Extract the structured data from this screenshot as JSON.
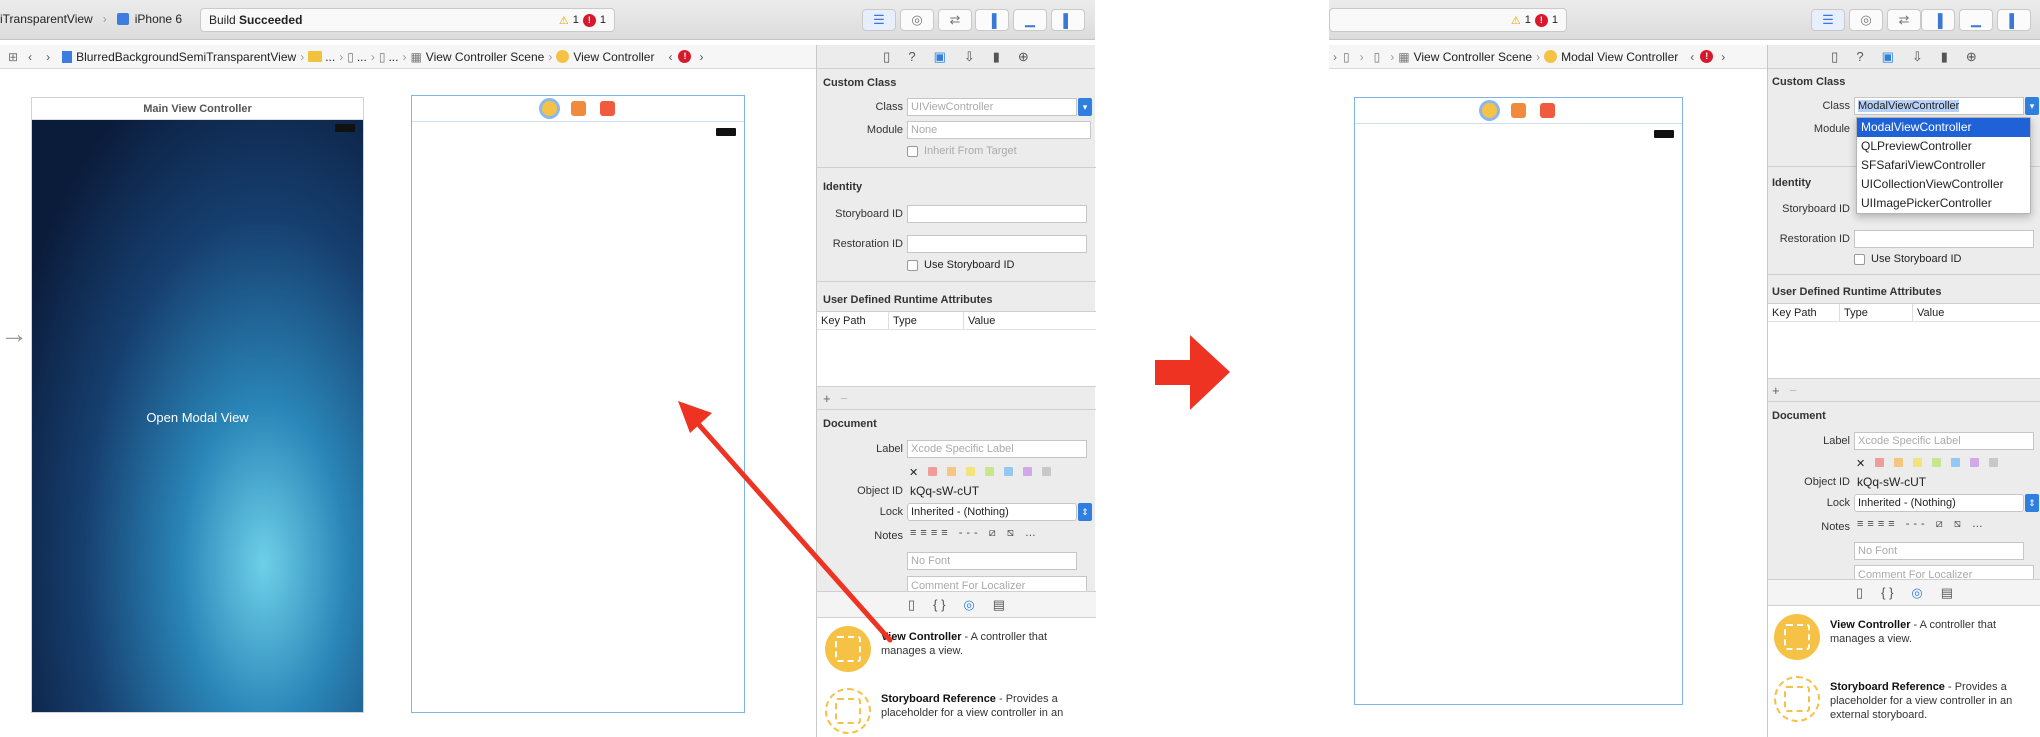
{
  "left": {
    "toolbar": {
      "scheme": "iTransparentView",
      "device": "iPhone 6",
      "status_prefix": "Build",
      "status_bold": "Succeeded",
      "warning_count": "1",
      "error_count": "1"
    },
    "pathbar": {
      "items": [
        "BlurredBackgroundSemiTransparentView",
        "...",
        "...",
        "...",
        "View Controller Scene",
        "View Controller"
      ]
    },
    "main_scene_title": "Main View Controller",
    "open_modal_label": "Open Modal View",
    "inspector": {
      "custom_class": {
        "title": "Custom Class",
        "class_label": "Class",
        "class_placeholder": "UIViewController",
        "module_label": "Module",
        "module_placeholder": "None",
        "inherit_label": "Inherit From Target"
      },
      "identity": {
        "title": "Identity",
        "storyboard_id_label": "Storyboard ID",
        "restoration_id_label": "Restoration ID",
        "use_storyboard_id_label": "Use Storyboard ID"
      },
      "runtime": {
        "title": "User Defined Runtime Attributes",
        "columns": [
          "Key Path",
          "Type",
          "Value"
        ]
      },
      "document": {
        "title": "Document",
        "label_label": "Label",
        "label_placeholder": "Xcode Specific Label",
        "object_id_label": "Object ID",
        "object_id": "kQq-sW-cUT",
        "lock_label": "Lock",
        "lock_value": "Inherited - (Nothing)",
        "notes_label": "Notes",
        "font_placeholder": "No Font",
        "comment_placeholder": "Comment For Localizer"
      },
      "library": [
        {
          "title": "View Controller",
          "desc": " - A controller that manages a view."
        },
        {
          "title": "Storyboard Reference",
          "desc": " - Provides a placeholder for a view controller in an"
        }
      ]
    }
  },
  "right": {
    "toolbar": {
      "warning_count": "1",
      "error_count": "1"
    },
    "pathbar": {
      "items": [
        "View Controller Scene",
        "Modal View Controller"
      ]
    },
    "inspector": {
      "custom_class": {
        "title": "Custom Class",
        "class_label": "Class",
        "class_value": "ModalViewController",
        "module_label": "Module"
      },
      "dropdown_options": [
        "ModalViewController",
        "QLPreviewController",
        "SFSafariViewController",
        "UICollectionViewController",
        "UIImagePickerController"
      ],
      "identity": {
        "title": "Identity",
        "storyboard_id_label": "Storyboard ID",
        "restoration_id_label": "Restoration ID",
        "use_storyboard_id_label": "Use Storyboard ID"
      },
      "runtime": {
        "title": "User Defined Runtime Attributes",
        "columns": [
          "Key Path",
          "Type",
          "Value"
        ]
      },
      "document": {
        "title": "Document",
        "label_label": "Label",
        "label_placeholder": "Xcode Specific Label",
        "object_id_label": "Object ID",
        "object_id": "kQq-sW-cUT",
        "lock_label": "Lock",
        "lock_value": "Inherited - (Nothing)",
        "notes_label": "Notes",
        "font_placeholder": "No Font",
        "comment_placeholder": "Comment For Localizer"
      },
      "library": [
        {
          "title": "View Controller",
          "desc": " - A controller that manages a view."
        },
        {
          "title": "Storyboard Reference",
          "desc": " - Provides a placeholder for a view controller in an external storyboard."
        }
      ]
    }
  },
  "colors": {
    "accent": "#2f7fe0",
    "arrow_red": "#ee3322",
    "scene_yellow": "#f5c246"
  }
}
